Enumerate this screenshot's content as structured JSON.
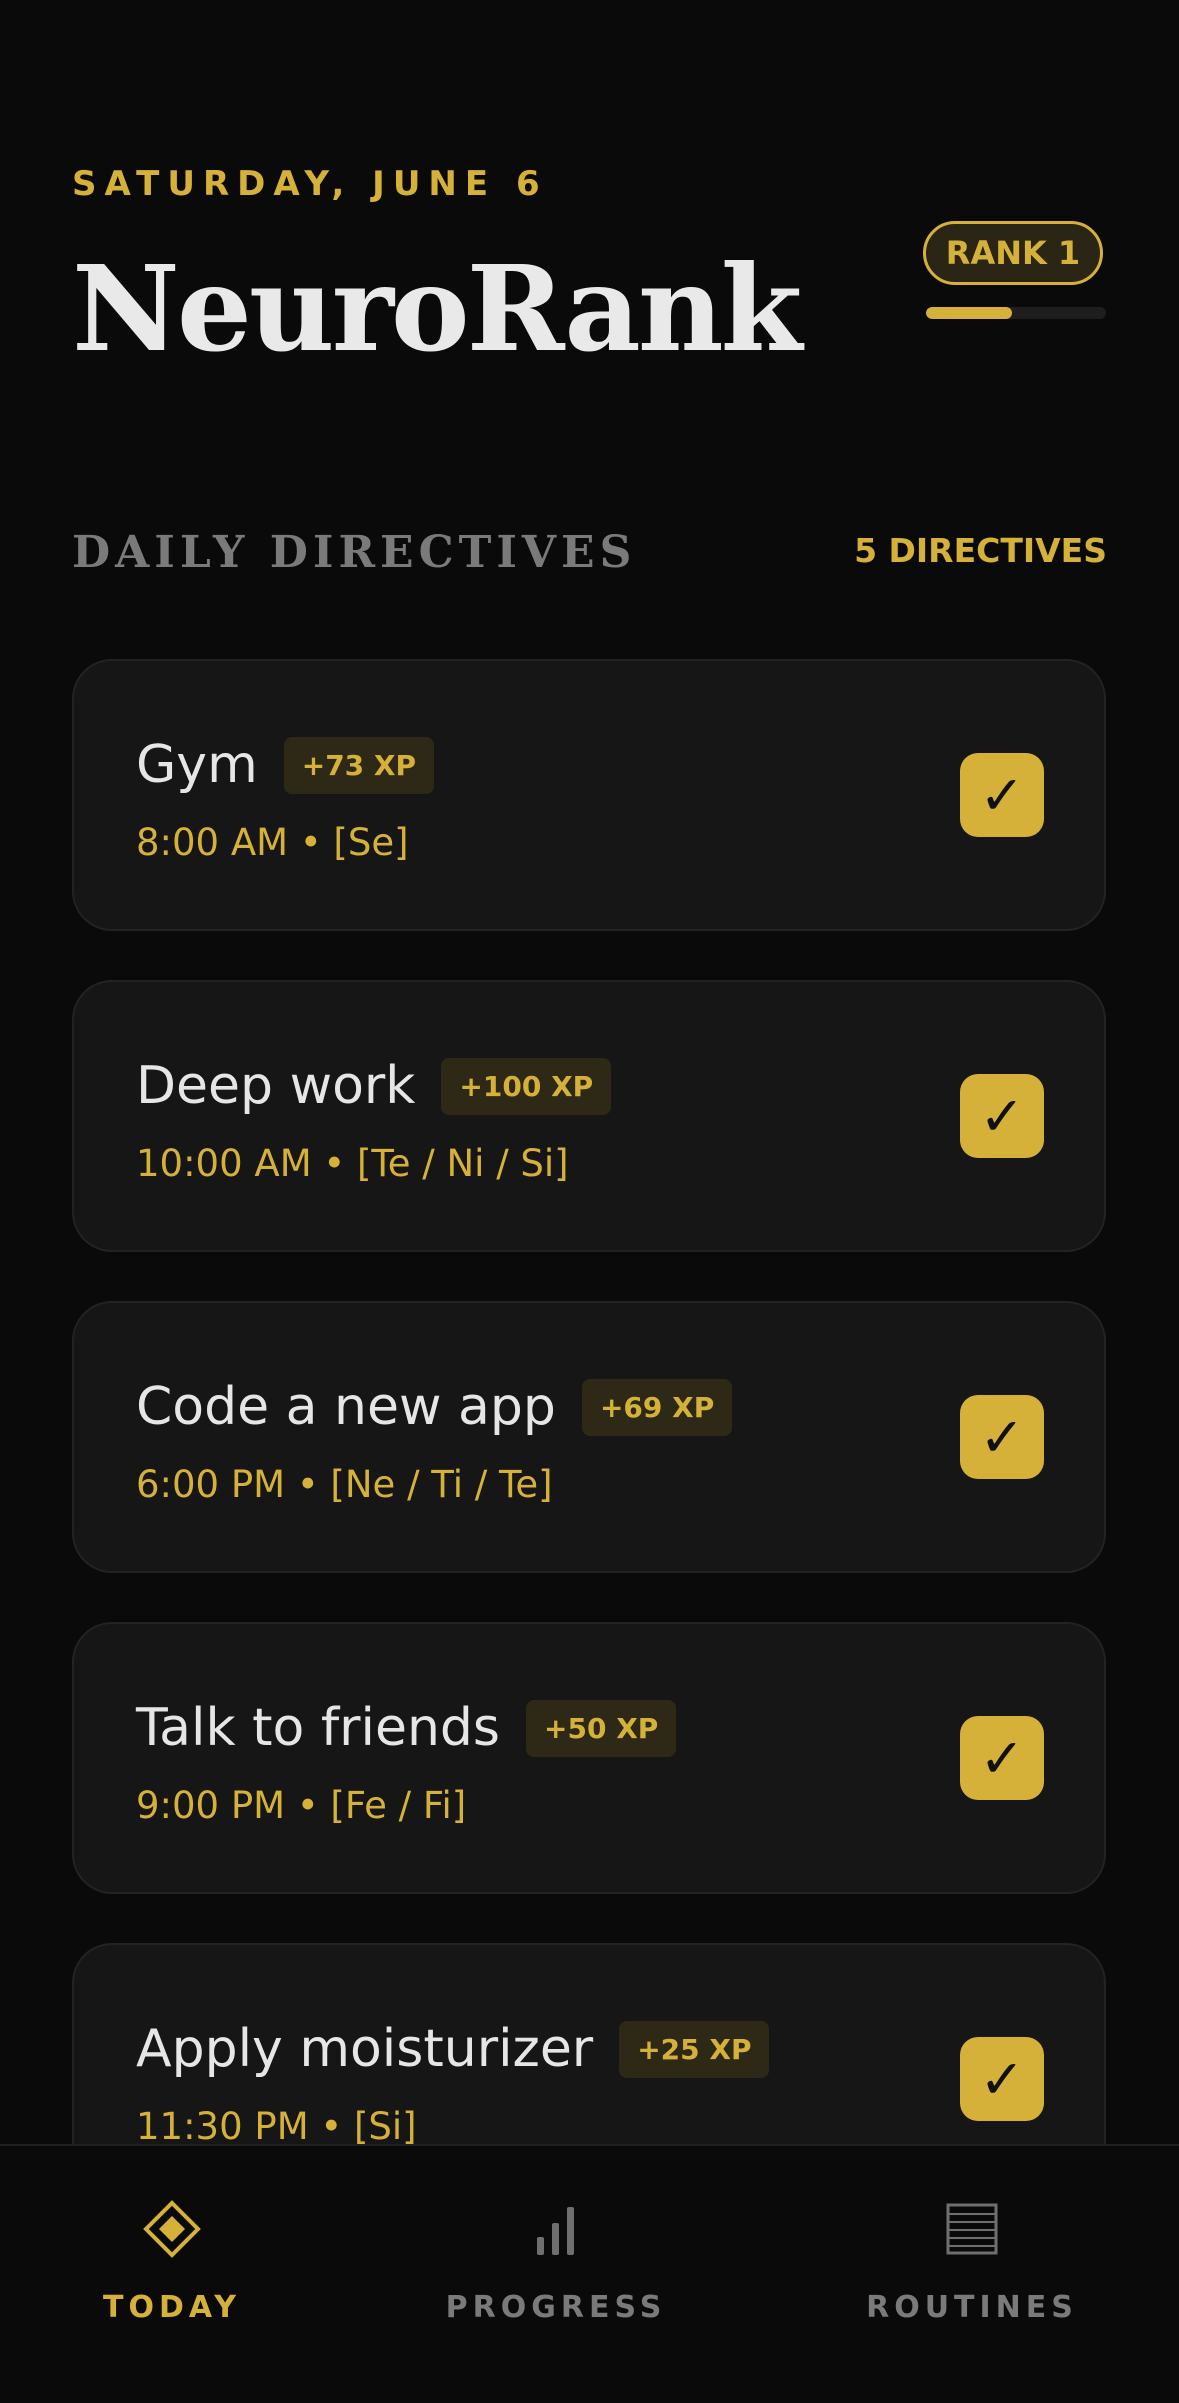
{
  "header": {
    "date": "SATURDAY, JUNE 6",
    "title": "NeuroRank",
    "rank_label": "RANK 1",
    "rank_progress": 0.48
  },
  "section": {
    "title": "DAILY DIRECTIVES",
    "count_label": "5 DIRECTIVES"
  },
  "directives": [
    {
      "name": "Gym",
      "xp": "+73 XP",
      "meta": "8:00 AM • [Se]",
      "checked": true
    },
    {
      "name": "Deep work",
      "xp": "+100 XP",
      "meta": "10:00 AM • [Te / Ni / Si]",
      "checked": true
    },
    {
      "name": "Code a new app",
      "xp": "+69 XP",
      "meta": "6:00 PM • [Ne / Ti / Te]",
      "checked": true
    },
    {
      "name": "Talk to friends",
      "xp": "+50 XP",
      "meta": "9:00 PM • [Fe / Fi]",
      "checked": true
    },
    {
      "name": "Apply moisturizer",
      "xp": "+25 XP",
      "meta": "11:30 PM • [Si]",
      "checked": true
    }
  ],
  "check_glyph": "✓",
  "tabs": [
    {
      "label": "TODAY",
      "icon": "diamond-icon",
      "active": true
    },
    {
      "label": "PROGRESS",
      "icon": "bar-chart-icon",
      "active": false
    },
    {
      "label": "ROUTINES",
      "icon": "list-icon",
      "active": false
    }
  ],
  "colors": {
    "accent": "#d6b13a",
    "background": "#0a0a0a",
    "card": "#161616",
    "muted": "#7a7a7a"
  }
}
